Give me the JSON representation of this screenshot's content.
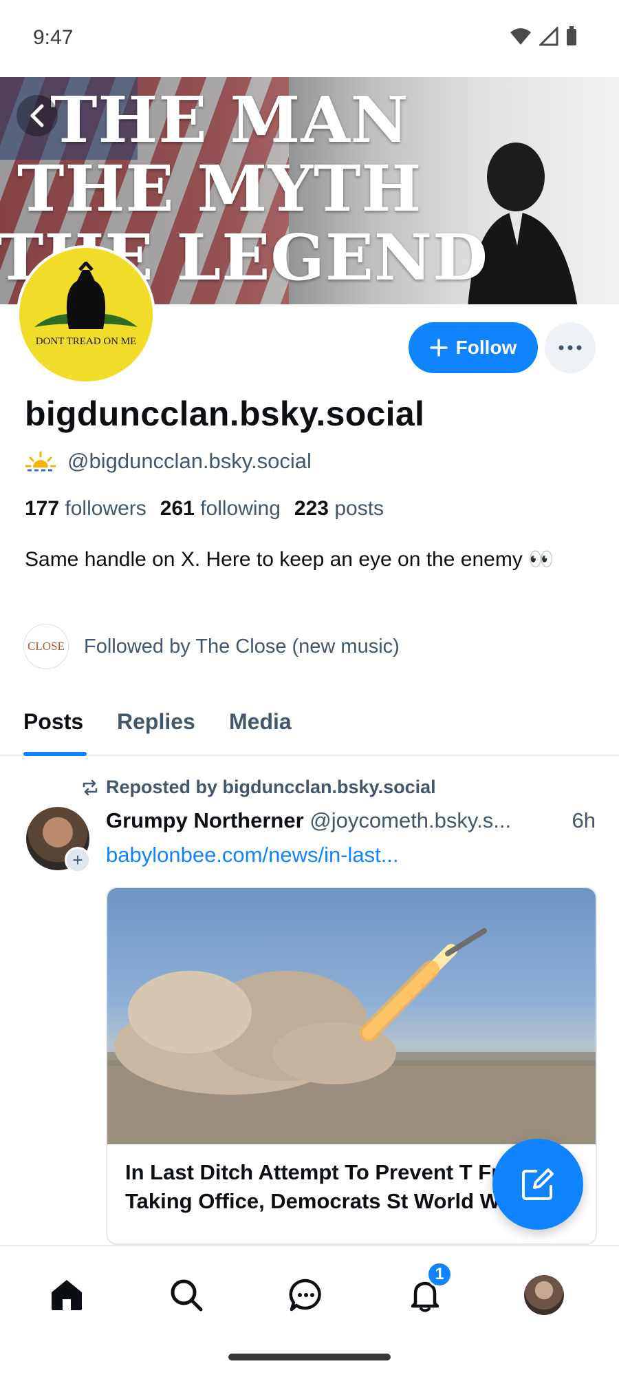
{
  "status_bar": {
    "time": "9:47"
  },
  "banner": {
    "lines": [
      "THE MAN",
      "THE MYTH",
      "THE LEGEND"
    ]
  },
  "avatar": {
    "caption": "DONT TREAD ON ME",
    "bg_color": "#f1dc2a"
  },
  "actions": {
    "follow_label": "Follow"
  },
  "profile": {
    "display_name": "bigduncclan.bsky.social",
    "handle": "@bigduncclan.bsky.social",
    "followers_count": "177",
    "followers_label": "followers",
    "following_count": "261",
    "following_label": "following",
    "posts_count": "223",
    "posts_label": "posts",
    "bio": "Same handle on X. Here to keep an eye on the enemy 👀",
    "followed_by": "Followed by The Close (new music)",
    "followed_by_avatar_text": "CLOSE"
  },
  "tabs": [
    {
      "label": "Posts",
      "active": true
    },
    {
      "label": "Replies",
      "active": false
    },
    {
      "label": "Media",
      "active": false
    }
  ],
  "post": {
    "repost_label": "Reposted by bigduncclan.bsky.social",
    "author": "Grumpy Northerner",
    "handle": "@joycometh.bsky.s...",
    "time": "6h",
    "link_text": "babylonbee.com/news/in-last...",
    "card_title": "In Last Ditch Attempt To Prevent T From Taking Office, Democrats St World War 3"
  },
  "nav": {
    "notification_badge": "1"
  },
  "colors": {
    "accent": "#1083fe",
    "muted_text": "#42576c"
  }
}
